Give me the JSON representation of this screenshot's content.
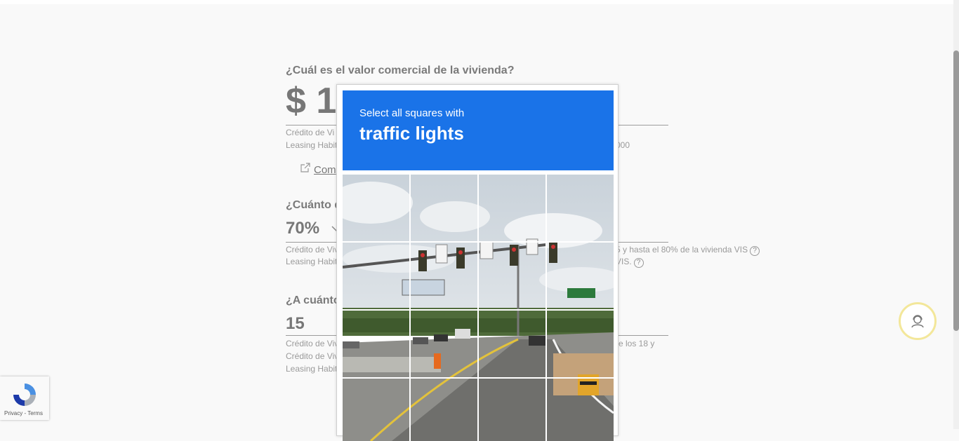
{
  "form": {
    "q1": "¿Cuál es el valor comercial de la vivienda?",
    "value1": "$ 1",
    "note1a": "Crédito de Vi",
    "note1b": "Leasing Habit",
    "note1c": "000",
    "link": "Com",
    "q2": "¿Cuánto d",
    "value2": "70%",
    "note2a": "Crédito de Viv",
    "note2a_end": "5 y hasta el 80% de la vivienda VIS",
    "note2b": "Leasing Habit",
    "note2b_end": "VIS.",
    "q3": "¿A cuánto",
    "value3": "15",
    "note3a": "Crédito de Viv",
    "note3a_end": "re los 18 y",
    "note3b": "Crédito de Viv",
    "note3c": "Leasing Habit",
    "help": "?"
  },
  "captcha": {
    "instruction": "Select all squares with",
    "target": "traffic lights"
  },
  "recaptcha": {
    "terms": "Privacy - Terms"
  },
  "icons": [
    "external-link-icon",
    "help-icon",
    "chevron-down-icon",
    "recaptcha-logo-icon",
    "support-agent-icon"
  ]
}
